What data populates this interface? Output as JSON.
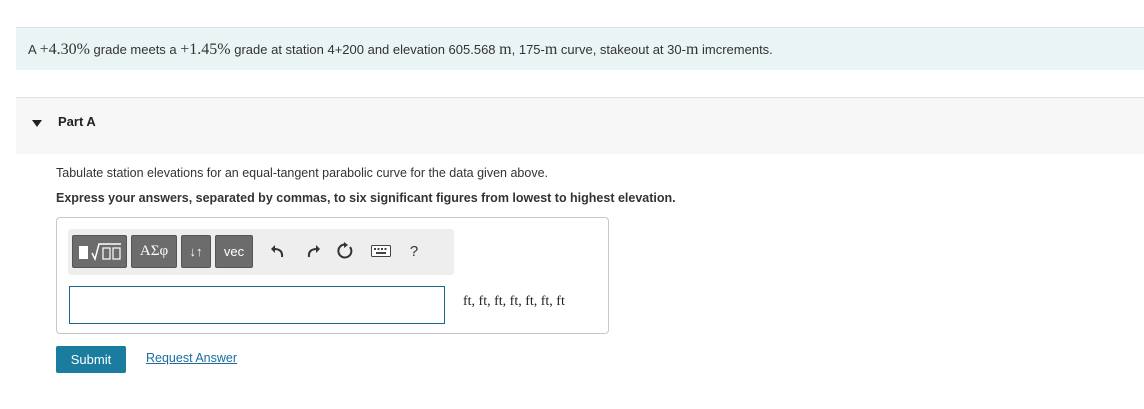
{
  "problem": {
    "prefix": "A ",
    "grade1": "+4.30%",
    "mid1": " grade meets a ",
    "grade2": "+1.45%",
    "mid2": " grade at station 4+200 and elevation 605.568 ",
    "unit_m": "m",
    "mid3": ", 175-",
    "unit_m2": "m",
    "mid4": " curve, stakeout at 30-",
    "unit_m3": "m",
    "suffix": " imcrements."
  },
  "part": {
    "title": "Part A"
  },
  "instructions": {
    "line1": "Tabulate station elevations for an equal-tangent parabolic curve for the data given above.",
    "line2": "Express your answers, separated by commas, to six significant figures from lowest to highest elevation."
  },
  "toolbar": {
    "greek_label": "ΑΣφ",
    "updown_label": "↓↑",
    "vec_label": "vec",
    "help_label": "?"
  },
  "answer": {
    "value": "",
    "units": "ft, ft, ft, ft, ft, ft, ft"
  },
  "actions": {
    "submit_label": "Submit",
    "request_label": "Request Answer"
  },
  "icons": [
    "templates-icon",
    "undo-icon",
    "redo-icon",
    "reset-icon",
    "keyboard-icon",
    "help-icon"
  ],
  "colors": {
    "accent": "#1a7c9e",
    "problem_bg": "#eaf4f4",
    "toolbar_btn": "#6c6c6c"
  }
}
